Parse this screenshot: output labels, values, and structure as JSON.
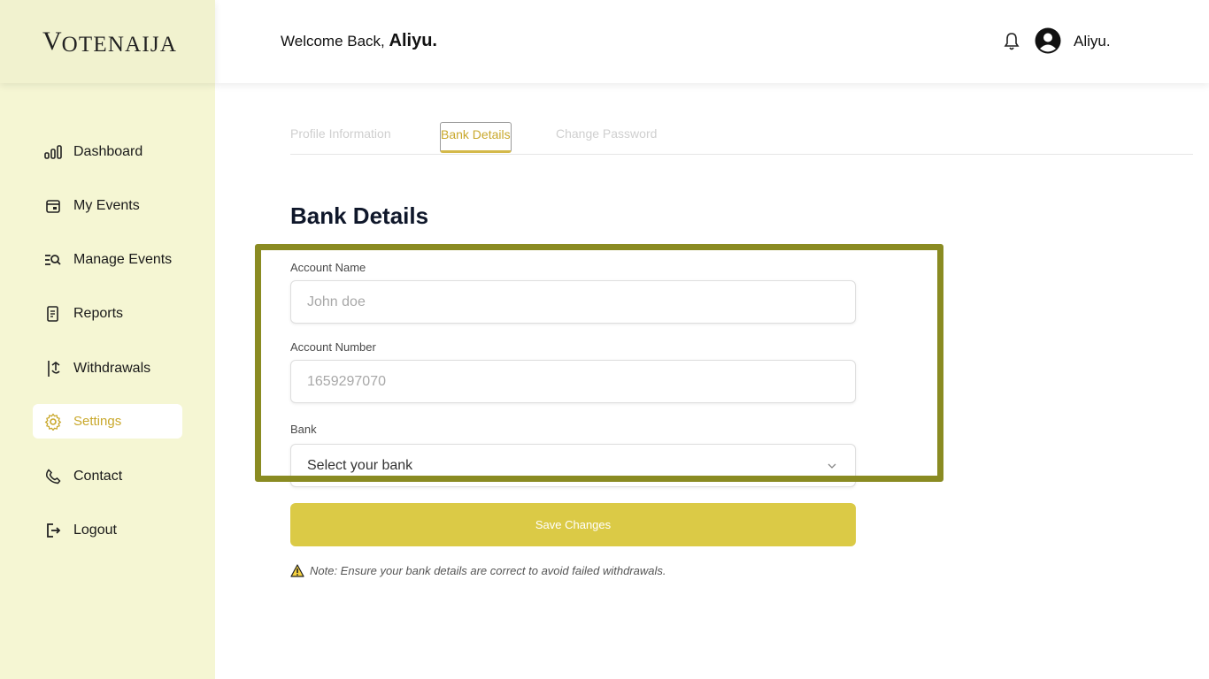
{
  "app": {
    "logo_first": "V",
    "logo_rest": "OTENAIJA"
  },
  "header": {
    "welcome_text": "Welcome Back,",
    "user_bold": "Aliyu.",
    "user_name": "Aliyu."
  },
  "sidebar": {
    "items": [
      {
        "label": "Dashboard",
        "icon": "bar-chart-icon"
      },
      {
        "label": "My Events",
        "icon": "calendar-icon"
      },
      {
        "label": "Manage Events",
        "icon": "search-list-icon"
      },
      {
        "label": "Reports",
        "icon": "document-icon"
      },
      {
        "label": "Withdrawals",
        "icon": "withdraw-icon"
      },
      {
        "label": "Settings",
        "icon": "gear-icon",
        "active": true
      },
      {
        "label": "Contact",
        "icon": "phone-icon"
      },
      {
        "label": "Logout",
        "icon": "logout-icon"
      }
    ]
  },
  "tabs": [
    {
      "label": "Profile Information"
    },
    {
      "label": "Bank Details",
      "active": true
    },
    {
      "label": "Change Password"
    }
  ],
  "form": {
    "title": "Bank Details",
    "account_name": {
      "label": "Account Name",
      "placeholder": "John doe"
    },
    "account_number": {
      "label": "Account Number",
      "placeholder": "1659297070"
    },
    "bank": {
      "label": "Bank",
      "value": "Select your bank"
    },
    "save_label": "Save Changes",
    "note": "Note: Ensure your bank details are correct to avoid failed withdrawals."
  },
  "colors": {
    "accent": "#c9a82c",
    "button": "#dbca46",
    "sidebar_bg": "#f5f6d3",
    "highlight": "#8a8b22"
  }
}
